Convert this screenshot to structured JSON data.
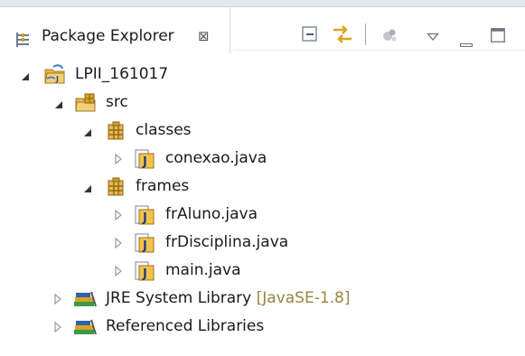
{
  "view": {
    "title": "Package Explorer",
    "close_glyph": "⊠",
    "icons": [
      "package-explorer-icon",
      "collapse-all-icon",
      "link-with-editor-icon",
      "focus-on-active-task-icon",
      "view-menu-icon",
      "minimize-icon",
      "maximize-icon"
    ]
  },
  "tree": {
    "project": "LPII_161017",
    "src": "src",
    "package_classes": "classes",
    "file_conexao": "conexao.java",
    "package_frames": "frames",
    "file_fraluno": "frAluno.java",
    "file_frdisciplina": "frDisciplina.java",
    "file_main": "main.java",
    "jre": "JRE System Library",
    "jre_decoration": "[JavaSE-1.8]",
    "referenced": "Referenced Libraries"
  },
  "colors": {
    "folder": "#e8b64a",
    "java_file": "#f4c24b",
    "library": "#3a9a4a",
    "twisty_expanded": "#333333",
    "twisty_collapsed": "#9a9a9a",
    "decoration": "#9a8242"
  }
}
